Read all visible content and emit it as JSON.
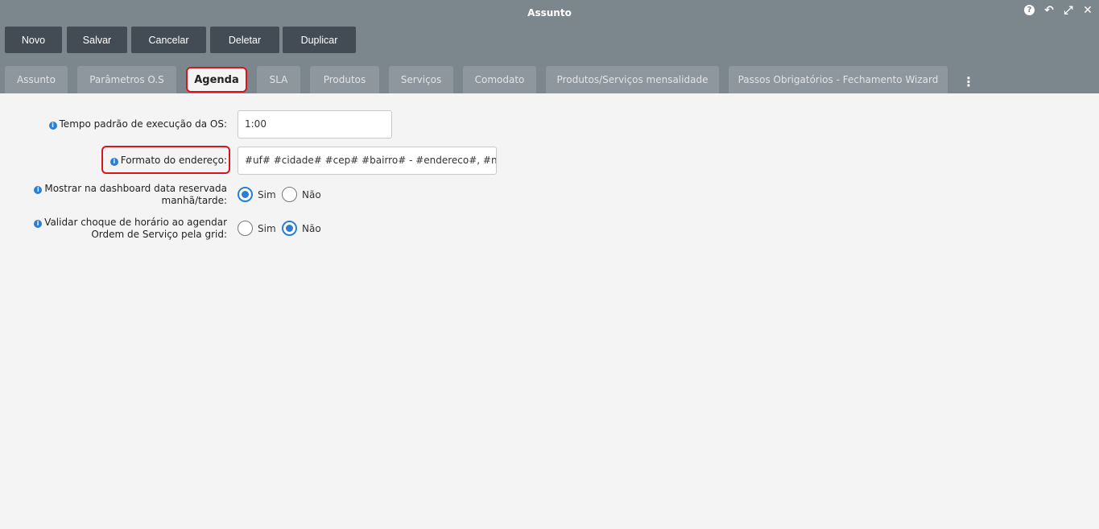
{
  "window": {
    "title": "Assunto"
  },
  "window_icons": {
    "help": "?",
    "history": "↶",
    "expand": "⤢",
    "close": "✕"
  },
  "toolbar": {
    "novo": "Novo",
    "salvar": "Salvar",
    "cancelar": "Cancelar",
    "deletar": "Deletar",
    "duplicar": "Duplicar"
  },
  "tabs": [
    "Assunto",
    "Parâmetros O.S",
    "Agenda",
    "SLA",
    "Produtos",
    "Serviços",
    "Comodato",
    "Produtos/Serviços mensalidade",
    "Passos Obrigatórios - Fechamento Wizard"
  ],
  "tabs_more": "⋮",
  "active_tab": "Agenda",
  "form": {
    "tempo": {
      "label": "Tempo padrão de execução da OS:",
      "value": "1:00"
    },
    "formato": {
      "label": "Formato do endereço:",
      "value": "#uf# #cidade# #cep# #bairro# - #endereco#, #numero#"
    },
    "mostrar": {
      "label_line1": "Mostrar na dashboard data reservada",
      "label_line2": "manhã/tarde:",
      "selected": "Sim"
    },
    "validar": {
      "label_line1": "Validar choque de horário ao agendar",
      "label_line2": "Ordem de Serviço pela grid:",
      "selected": "Não"
    },
    "option_sim": "Sim",
    "option_nao": "Não",
    "info_glyph": "i"
  },
  "colors": {
    "header": "#7c878d",
    "button": "#434c54",
    "highlight": "#d6161d",
    "accent": "#2a7fd1"
  }
}
